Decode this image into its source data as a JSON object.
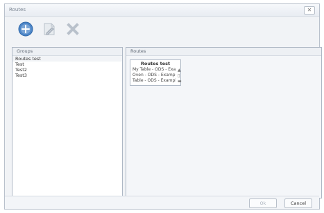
{
  "window": {
    "title": "Routes",
    "close_label": "✕"
  },
  "toolbar": {
    "add_icon": "plus-circle-icon",
    "edit_icon": "edit-icon",
    "delete_icon": "delete-icon"
  },
  "groups": {
    "header": "Groups",
    "items": [
      "Routes test",
      "Test",
      "Test2",
      "Test3"
    ]
  },
  "routes": {
    "header": "Routes",
    "box_title": "Routes test",
    "items": [
      {
        "label": "My Table - ODS - Example",
        "icon": "▲"
      },
      {
        "label": "Oven - ODS - Example",
        "icon": "▯"
      },
      {
        "label": "Table - ODS - Example",
        "icon": "▬"
      }
    ]
  },
  "footer": {
    "ok_label": "Ok",
    "cancel_label": "Cancel"
  },
  "colors": {
    "accent": "#4d86c8",
    "border": "#aeb8c5",
    "disabled": "#aab2bd"
  }
}
